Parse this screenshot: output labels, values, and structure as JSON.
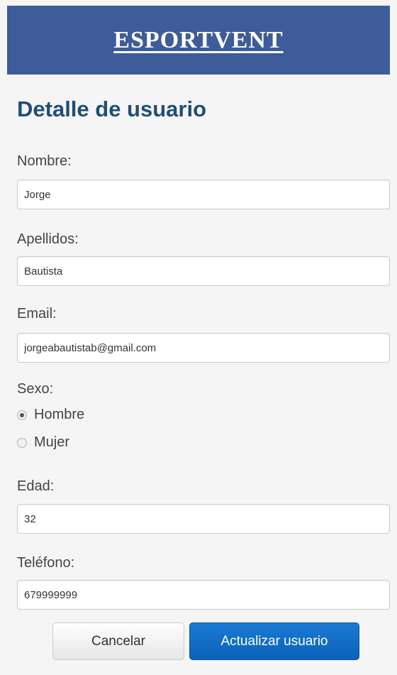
{
  "header": {
    "brand": "ESPORTVENT"
  },
  "page": {
    "title": "Detalle de usuario"
  },
  "form": {
    "nombre": {
      "label": "Nombre:",
      "value": "Jorge"
    },
    "apellidos": {
      "label": "Apellidos:",
      "value": "Bautista"
    },
    "email": {
      "label": "Email:",
      "value": "jorgeabautistab@gmail.com"
    },
    "sexo": {
      "label": "Sexo:",
      "options": [
        "Hombre",
        "Mujer"
      ],
      "selected": "Hombre"
    },
    "edad": {
      "label": "Edad:",
      "value": "32"
    },
    "telefono": {
      "label": "Teléfono:",
      "value": "679999999"
    }
  },
  "buttons": {
    "cancel": "Cancelar",
    "update": "Actualizar usuario"
  },
  "colors": {
    "header_bg": "#3e5b9a",
    "title": "#1f4e79",
    "primary_button": "#0b62b8"
  }
}
